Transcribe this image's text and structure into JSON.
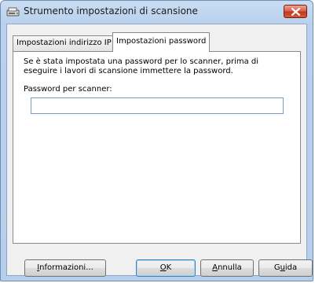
{
  "window": {
    "title": "Strumento impostazioni di scansione",
    "app_icon": "scanner-icon",
    "close_icon": "close-icon"
  },
  "tabs": [
    {
      "label": "Impostazioni indirizzo IP",
      "selected": false
    },
    {
      "label": "Impostazioni password",
      "selected": true
    }
  ],
  "panel": {
    "description": "Se è stata impostata una password per lo scanner, prima di eseguire i lavori di scansione immettere la password.",
    "field_label": "Password per scanner:",
    "password_value": ""
  },
  "buttons": {
    "info": {
      "label": "Informazioni...",
      "mnemonic": "I",
      "rest": "nformazioni..."
    },
    "ok": {
      "label": "OK",
      "mnemonic": "O",
      "rest": "K"
    },
    "annulla": {
      "label": "Annulla",
      "mnemonic": "A",
      "rest": "nnulla"
    },
    "guida": {
      "label": "Guida",
      "pre": "G",
      "mnemonic": "u",
      "rest": "ida"
    }
  },
  "colors": {
    "titlebar": "#b9d1ee",
    "close": "#c2381e",
    "client": "#f0f0f0"
  }
}
